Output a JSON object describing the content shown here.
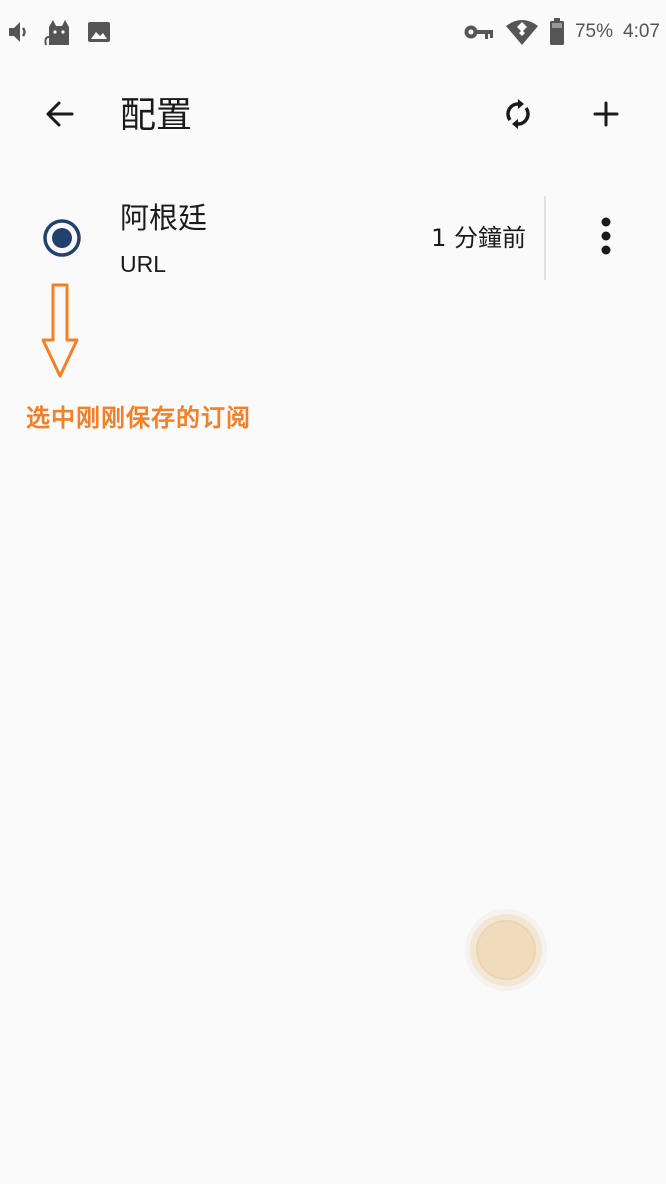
{
  "status_bar": {
    "battery": "75%",
    "time": "4:07"
  },
  "app_bar": {
    "title": "配置"
  },
  "profiles": [
    {
      "name": "阿根廷",
      "type": "URL",
      "updated": "1 分鐘前",
      "selected": true
    }
  ],
  "annotation": {
    "text": "选中刚刚保存的订阅",
    "color": "#f47f24"
  },
  "colors": {
    "radio_selected": "#23416e",
    "background": "#fafafa",
    "icon": "#1a1a1a"
  },
  "icons": {
    "status_left": [
      "volume-icon",
      "cat-icon",
      "image-icon"
    ],
    "status_right": [
      "key-icon",
      "wifi-icon",
      "battery-icon"
    ],
    "app_bar": [
      "back-arrow-icon",
      "refresh-icon",
      "add-icon"
    ],
    "row": [
      "radio-icon",
      "more-vert-icon"
    ]
  }
}
